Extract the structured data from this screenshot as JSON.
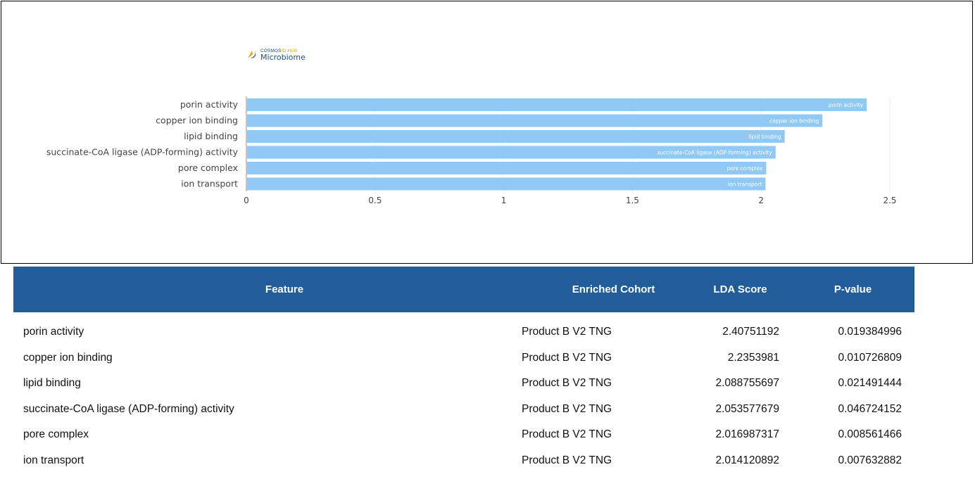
{
  "logo": {
    "brand_part1": "COSMOS",
    "brand_part2": "ID-HUB",
    "subtitle": "Microbiome"
  },
  "colors": {
    "bar": "#90c9f6",
    "header_bg": "#215e99",
    "axis_line": "#888888"
  },
  "chart_data": {
    "type": "bar",
    "orientation": "horizontal",
    "categories": [
      "porin activity",
      "copper ion binding",
      "lipid binding",
      "succinate-CoA ligase (ADP-forming) activity",
      "pore complex",
      "ion transport"
    ],
    "values": [
      2.40751192,
      2.2353981,
      2.088755697,
      2.053577679,
      2.016987317,
      2.014120892
    ],
    "bar_labels": [
      "porin activity",
      "copper ion binding",
      "lipid binding",
      "succinate-CoA ligase (ADP-forming) activity",
      "pore complex",
      "ion transport"
    ],
    "x_ticks": [
      "0",
      "0.5",
      "1",
      "1.5",
      "2",
      "2.5"
    ],
    "x_tick_values": [
      0,
      0.5,
      1,
      1.5,
      2,
      2.5
    ],
    "xlim": [
      0,
      2.5
    ],
    "grid": true
  },
  "table": {
    "headers": {
      "feature": "Feature",
      "cohort": "Enriched Cohort",
      "lda": "LDA Score",
      "pvalue": "P-value"
    },
    "rows": [
      {
        "feature": "porin activity",
        "cohort": "Product B V2 TNG",
        "lda": "2.40751192",
        "pvalue": "0.019384996"
      },
      {
        "feature": "copper ion binding",
        "cohort": "Product B V2 TNG",
        "lda": "2.2353981",
        "pvalue": "0.010726809"
      },
      {
        "feature": "lipid binding",
        "cohort": "Product B V2 TNG",
        "lda": "2.088755697",
        "pvalue": "0.021491444"
      },
      {
        "feature": "succinate-CoA ligase (ADP-forming) activity",
        "cohort": "Product B V2 TNG",
        "lda": "2.053577679",
        "pvalue": "0.046724152"
      },
      {
        "feature": "pore complex",
        "cohort": "Product B V2 TNG",
        "lda": "2.016987317",
        "pvalue": "0.008561466"
      },
      {
        "feature": "ion transport",
        "cohort": "Product B V2 TNG",
        "lda": "2.014120892",
        "pvalue": "0.007632882"
      }
    ]
  }
}
